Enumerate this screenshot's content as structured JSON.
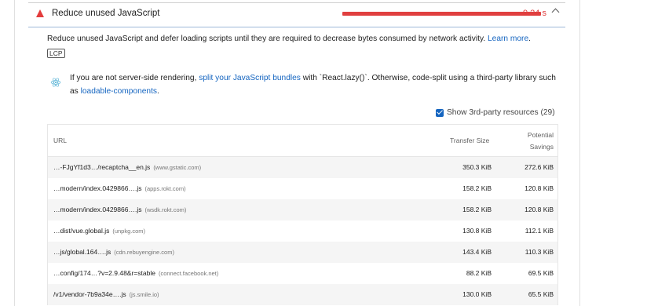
{
  "audit": {
    "title": "Reduce unused JavaScript",
    "savings": "9.24 s",
    "description_text": "Reduce unused JavaScript and defer loading scripts until they are required to decrease bytes consumed by network activity.",
    "learn_more": "Learn more",
    "chip": "LCP"
  },
  "hint": {
    "before": "If you are not server-side rendering,",
    "link1": "split your JavaScript bundles",
    "middle": "with `React.lazy()`. Otherwise, code-split using a third-party library such as",
    "link2": "loadable-components",
    "after": "."
  },
  "third_party": {
    "label": "Show 3rd-party resources (29)",
    "checked": true
  },
  "table": {
    "headers": {
      "url": "URL",
      "size": "Transfer Size",
      "savings_line1": "Potential",
      "savings_line2": "Savings"
    },
    "rows": [
      {
        "url": "…-FJgYf1d3…/recaptcha__en.js",
        "host": "(www.gstatic.com)",
        "size": "350.3 KiB",
        "savings": "272.6 KiB"
      },
      {
        "url": "…modern/index.0429866….js",
        "host": "(apps.rokt.com)",
        "size": "158.2 KiB",
        "savings": "120.8 KiB"
      },
      {
        "url": "…modern/index.0429866….js",
        "host": "(wsdk.rokt.com)",
        "size": "158.2 KiB",
        "savings": "120.8 KiB"
      },
      {
        "url": "…dist/vue.global.js",
        "host": "(unpkg.com)",
        "size": "130.8 KiB",
        "savings": "112.1 KiB"
      },
      {
        "url": "…js/global.164….js",
        "host": "(cdn.rebuyengine.com)",
        "size": "143.4 KiB",
        "savings": "110.3 KiB"
      },
      {
        "url": "…config/174…?v=2.9.48&r=stable",
        "host": "(connect.facebook.net)",
        "size": "88.2 KiB",
        "savings": "69.5 KiB"
      },
      {
        "url": "/v1/vendor-7b9a34e….js",
        "host": "(js.smile.io)",
        "size": "130.0 KiB",
        "savings": "65.5 KiB"
      }
    ]
  }
}
